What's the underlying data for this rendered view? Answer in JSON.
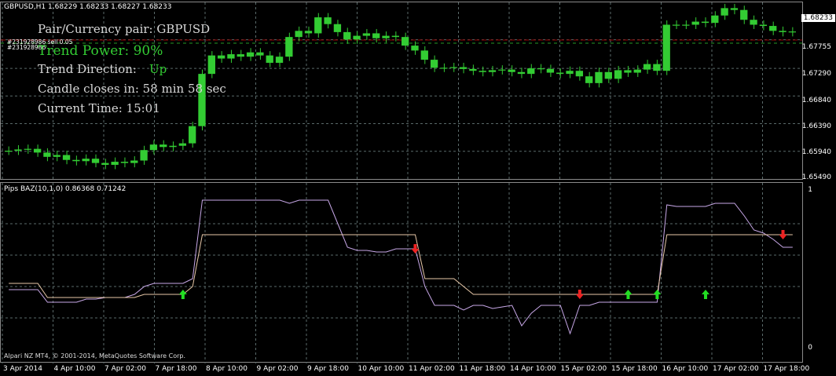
{
  "header": {
    "symbol_line": "GBPUSD,H1  1.68229 1.68233 1.68227 1.68233",
    "indicator_line": "Pips BAZ(10,1,0) 0.86368 0.71242"
  },
  "info": {
    "pair": "Pair/Currency pair: GBPUSD",
    "trend_power": "Trend Power: 90%",
    "trend_direction_label": "Trend Direction:",
    "trend_direction_value": "Up",
    "candle_close": "Candle closes in: 58 min 58 sec",
    "current_time": "Current Time: 15:01"
  },
  "orders": {
    "order_a": "#231928986 sell 0.05",
    "order_b": "#231928986 "
  },
  "price_tag": "1.68233",
  "copyright": "Alpari NZ MT4, © 2001-2014, MetaQuotes Software Corp.",
  "colors": {
    "candles": "#33cc33",
    "grid": "#5a6a6a",
    "order_line": "#990000",
    "trend_line": "#33cc33",
    "line_main": "#c8a8e8",
    "line_signal": "#e8c8a8",
    "arrow_up": "#22dd22",
    "arrow_down": "#ee2222"
  },
  "chart_data": [
    {
      "type": "line",
      "title": "GBPUSD,H1",
      "y_ticks": [
        "1.68233",
        "1.67755",
        "1.67290",
        "1.66840",
        "1.66390",
        "1.65940",
        "1.65490"
      ],
      "ylim": [
        1.6549,
        1.683
      ],
      "x_ticks": [
        "3 Apr 2014",
        "4 Apr 10:00",
        "7 Apr 02:00",
        "7 Apr 18:00",
        "8 Apr 10:00",
        "9 Apr 02:00",
        "9 Apr 18:00",
        "10 Apr 10:00",
        "11 Apr 02:00",
        "11 Apr 18:00",
        "14 Apr 10:00",
        "15 Apr 02:00",
        "15 Apr 18:00",
        "16 Apr 10:00",
        "17 Apr 02:00",
        "17 Apr 18:00"
      ],
      "close": [
        1.6595,
        1.6597,
        1.6598,
        1.6592,
        1.6585,
        1.6588,
        1.658,
        1.6578,
        1.6582,
        1.6575,
        1.6572,
        1.6577,
        1.6575,
        1.6579,
        1.6596,
        1.6605,
        1.6601,
        1.6603,
        1.6607,
        1.6635,
        1.672,
        1.675,
        1.6745,
        1.6752,
        1.6748,
        1.6755,
        1.675,
        1.6738,
        1.6748,
        1.678,
        1.679,
        1.6786,
        1.6812,
        1.6801,
        1.6788,
        1.6776,
        1.6782,
        1.6786,
        1.6778,
        1.6782,
        1.678,
        1.6766,
        1.6758,
        1.6743,
        1.673,
        1.673,
        1.6731,
        1.6728,
        1.6725,
        1.6723,
        1.6726,
        1.6727,
        1.6723,
        1.672,
        1.6729,
        1.6728,
        1.6722,
        1.672,
        1.6725,
        1.6716,
        1.6705,
        1.6723,
        1.6712,
        1.6726,
        1.6722,
        1.6727,
        1.6736,
        1.6725,
        1.68,
        1.68,
        1.68,
        1.6805,
        1.6803,
        1.6815,
        1.6827,
        1.6824,
        1.6808,
        1.68,
        1.6798,
        1.679,
        1.6788,
        1.6789
      ],
      "order_level": 1.6775,
      "trend_level": 1.677
    },
    {
      "type": "line",
      "title": "Pips BAZ(10,1,0)",
      "y_ticks": [
        "1",
        "0"
      ],
      "ylim": [
        0,
        1
      ],
      "series": [
        {
          "name": "",
          "values": [
            0.38,
            0.38,
            0.38,
            0.38,
            0.3,
            0.3,
            0.3,
            0.3,
            0.32,
            0.32,
            0.33,
            0.33,
            0.33,
            0.35,
            0.4,
            0.42,
            0.42,
            0.42,
            0.42,
            0.45,
            0.95,
            0.95,
            0.95,
            0.95,
            0.95,
            0.95,
            0.95,
            0.95,
            0.95,
            0.93,
            0.95,
            0.95,
            0.95,
            0.95,
            0.8,
            0.65,
            0.63,
            0.63,
            0.62,
            0.62,
            0.64,
            0.64,
            0.64,
            0.4,
            0.28,
            0.28,
            0.28,
            0.25,
            0.28,
            0.28,
            0.26,
            0.27,
            0.28,
            0.15,
            0.23,
            0.28,
            0.28,
            0.28,
            0.1,
            0.28,
            0.28,
            0.3,
            0.3,
            0.3,
            0.3,
            0.3,
            0.3,
            0.3,
            0.92,
            0.91,
            0.91,
            0.91,
            0.91,
            0.93,
            0.93,
            0.93,
            0.85,
            0.76,
            0.74,
            0.7,
            0.65,
            0.65
          ]
        },
        {
          "name": "",
          "values": [
            0.42,
            0.42,
            0.42,
            0.42,
            0.33,
            0.33,
            0.33,
            0.33,
            0.33,
            0.33,
            0.33,
            0.33,
            0.33,
            0.33,
            0.35,
            0.35,
            0.35,
            0.35,
            0.35,
            0.4,
            0.73,
            0.73,
            0.73,
            0.73,
            0.73,
            0.73,
            0.73,
            0.73,
            0.73,
            0.73,
            0.73,
            0.73,
            0.73,
            0.73,
            0.73,
            0.73,
            0.73,
            0.73,
            0.73,
            0.73,
            0.73,
            0.73,
            0.73,
            0.45,
            0.45,
            0.45,
            0.45,
            0.4,
            0.35,
            0.35,
            0.35,
            0.35,
            0.35,
            0.35,
            0.35,
            0.35,
            0.35,
            0.35,
            0.35,
            0.35,
            0.35,
            0.35,
            0.35,
            0.35,
            0.35,
            0.35,
            0.35,
            0.35,
            0.73,
            0.73,
            0.73,
            0.73,
            0.73,
            0.73,
            0.73,
            0.73,
            0.73,
            0.73,
            0.73,
            0.73,
            0.73,
            0.73
          ]
        }
      ],
      "signals": [
        {
          "dir": "up",
          "index": 18,
          "value": 0.35
        },
        {
          "dir": "down",
          "index": 42,
          "value": 0.64
        },
        {
          "dir": "down",
          "index": 59,
          "value": 0.35
        },
        {
          "dir": "up",
          "index": 64,
          "value": 0.35
        },
        {
          "dir": "up",
          "index": 67,
          "value": 0.35
        },
        {
          "dir": "up",
          "index": 72,
          "value": 0.35
        },
        {
          "dir": "down",
          "index": 80,
          "value": 0.73
        }
      ]
    }
  ]
}
